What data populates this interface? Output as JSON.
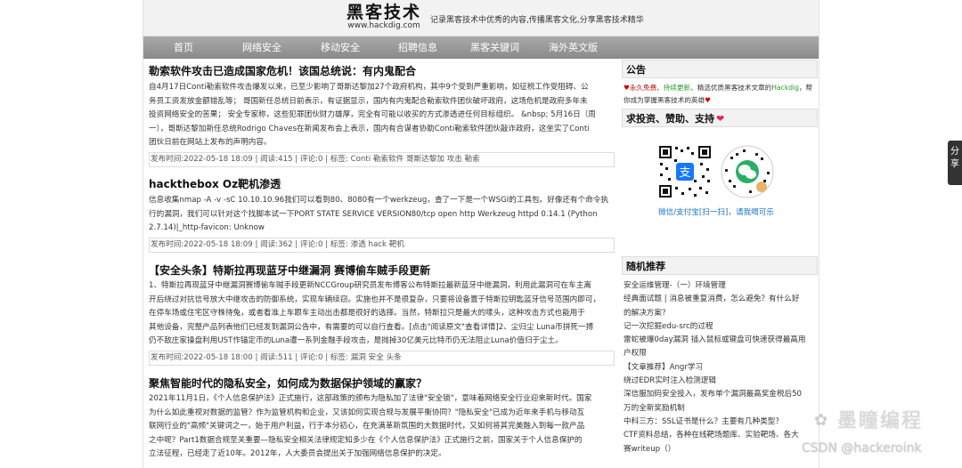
{
  "header": {
    "logo_text": "黑客技术",
    "logo_url": "www.hackdig.com",
    "slogan": "记录黑客技术中优秀的内容,传播黑客文化,分享黑客技术精华"
  },
  "nav": [
    {
      "label": "首页"
    },
    {
      "label": "网络安全"
    },
    {
      "label": "移动安全"
    },
    {
      "label": "招聘信息"
    },
    {
      "label": "黑客关键词"
    },
    {
      "label": "海外英文版"
    }
  ],
  "articles": [
    {
      "title": "勒索软件攻击已造成国家危机！该国总统说：有内鬼配合",
      "lines": [
        "自4月17日Conti勒索软件攻击爆发以来，已至少影响了哥斯达黎加27个政府机构，其中9个受到严重影响，如征税工作受阻碍、公",
        "务员工资发放金额错乱等；  哥国新任总统日前表示，有证据显示，国内有内鬼配合勒索软件团伙破坏政府，这场危机是政府多年未",
        "投资网络安全的苦果；  安全专家称，这些犯罪团伙财力雄厚，完全有可能以收买的方式渗透进任何目标组织。  &nbsp; 5月16日（周",
        "一），哥斯达黎加新任总统Rodrigo Chaves在新闻发布会上表示，国内有合谋者协助Conti勒索软件团伙敲诈政府，这坐实了Conti",
        "团伙日前在网站上发布的声明内容。"
      ],
      "meta": "发布时间:2022-05-18 18:09 | 阅读:415 | 评论:0 | 标签: Conti 勒索软件 哥斯达黎加 攻击 勒索"
    },
    {
      "title": "hackthebox Oz靶机渗透",
      "lines": [
        "信息收集nmap -A -v -sC 10.10.10.96我们可以看到80、8080有一个werkzeug，查了一下是一个WSGI的工具包。好像还有个命令执",
        "行的漏洞，我们可以针对这个找脚本试一下PORT STATE SERVICE VERSION80/tcp open http Werkzeug httpd 0.14.1 (Python",
        "2.7.14)|_http-favicon: Unknow"
      ],
      "meta": "发布时间:2022-05-18 18:09 | 阅读:362 | 评论:0 | 标签: 渗透 hack 靶机"
    },
    {
      "title": "【安全头条】特斯拉再现蓝牙中继漏洞 赛博偷车贼手段更新",
      "lines": [
        "1、特斯拉再现蓝牙中继漏洞赛博偷车贼手段更新NCCGroup研究员发布博客公布特斯拉最新蓝牙中继漏洞，利用此漏洞可在车主离",
        "开后绕过对抗信号放大中继攻击的防御系统，实现车辆续窃。实施也并不是很复杂，只要将设备置于特斯拉钥匙蓝牙信号范围内即可，",
        "在停车场或住宅区守株待兔，或者看准上车跟车主动出击都是很好的选择。当然，特斯拉只是最大的嗉头，这种攻击方式也能用于",
        "其他设备，完整产品列表他们已经发到漏洞公告中，有需要的可以自行查看。[点击\"阅读原文\"查看详情]2、尘归尘 Luna币拼死一搏",
        "仍不敌庄家操盘利用UST作锚定币的Luna遭一系列金融手段攻击，是抛掉30亿美元比特币仍无法阻止Luna价值归于尘土。"
      ],
      "meta": "发布时间:2022-05-18 18:00 | 阅读:511 | 评论:0 | 标签: 漏洞 安全 头条"
    },
    {
      "title": "聚焦智能时代的隐私安全，如何成为数据保护领域的赢家？",
      "lines": [
        "2021年11月1日，《个人信息保护法》正式施行，这部政策的颁布为隐私加了法律\"安全锁\"，意味着网络安全行业迎来新时代。国家",
        "为什么如此重视对数据的监管？作为监管机构和企业，又该如何实现合规与发展平衡协同？\"隐私安全\"已成为近年来手机与移动互",
        "联网行业的\"高频\"关键词之一，始于用户利益，行于本分初心，在充满革新氛围的大数据时代，又如何将其完美融入到每一款产品",
        "之中呢？Part1数据合规至关重要—隐私安全相关法律规定知多少在《个人信息保护法》正式施行之前，国家关于个人信息保护的",
        "立法征程，已经走了近10年。2012年，人大委员会提出关于加强网络信息保护的决定。"
      ]
    }
  ],
  "sidebar": {
    "notice_title": "公告",
    "notice_lines": [
      [
        "♥",
        "永久免费",
        "、",
        "持续更新",
        "、精选优质黑客技术文章的",
        "Hackdig",
        "，帮"
      ],
      [
        "你成为掌握黑客技术的英雄",
        "♥"
      ]
    ],
    "support_title": "求投资、赞助、支持",
    "heart": "❤",
    "pay_caption": "微信/支付宝[扫一扫]，请我喝可乐",
    "random_title": "随机推荐",
    "random_items": [
      "安全运维管理-（一）环境管理",
      "经典面试题 | 消息被重复消费，怎么避免？有什么好",
      "的解决方案？",
      "记一次挖掘edu-src的过程",
      "雷蛇被爆0day漏洞 插入鼠标或键盘可快速获得最高用",
      "户权限",
      "【文章推荐】Angr学习",
      "绕过EDR实时注入检测逻辑",
      "深信服加码安全投入，发布单个漏洞最高奖金税后50",
      "万的全新奖励机制",
      "中科三方：SSL证书是什么？主要有几种类型？",
      "CTF资料总结，各种在线靶场题库、实验靶场、各大",
      "赛writeup（）"
    ]
  },
  "share_tab": "分享",
  "watermark": {
    "brand": "墨瞳编程",
    "csdn": "CSDN @hackeroink"
  }
}
